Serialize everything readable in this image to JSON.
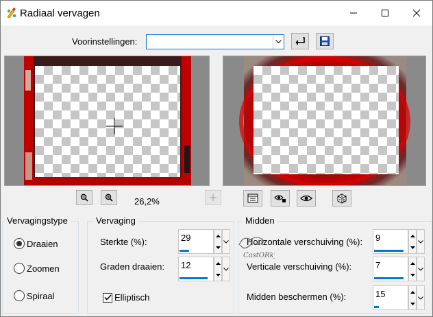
{
  "window": {
    "title": "Radiaal vervagen"
  },
  "presets": {
    "label": "Voorinstellingen:",
    "value": ""
  },
  "preview": {
    "zoom_level": "26,2%"
  },
  "blur_type": {
    "title": "Vervagingstype",
    "options": [
      {
        "label": "Draaien",
        "selected": true
      },
      {
        "label": "Zoomen",
        "selected": false
      },
      {
        "label": "Spiraal",
        "selected": false
      }
    ]
  },
  "blur": {
    "title": "Vervaging",
    "strength_label": "Sterkte (%):",
    "strength_value": "29",
    "strength_fraction": 0.29,
    "degrees_label": "Graden draaien:",
    "degrees_value": "12",
    "degrees_fraction": 0.85,
    "elliptical_label": "Elliptisch",
    "elliptical_checked": true
  },
  "center": {
    "title": "Midden",
    "horizontal_label": "Horizontale verschuiving (%):",
    "horizontal_value": "9",
    "horizontal_fraction": 0.9,
    "vertical_label": "Verticale verschuiving (%):",
    "vertical_value": "7",
    "vertical_fraction": 0.9,
    "protect_label": "Midden beschermen (%):",
    "protect_value": "15",
    "protect_fraction": 0.15
  },
  "watermark": {
    "text": "CastORky"
  },
  "colors": {
    "accent": "#0078d7",
    "image_red": "#c00000"
  }
}
